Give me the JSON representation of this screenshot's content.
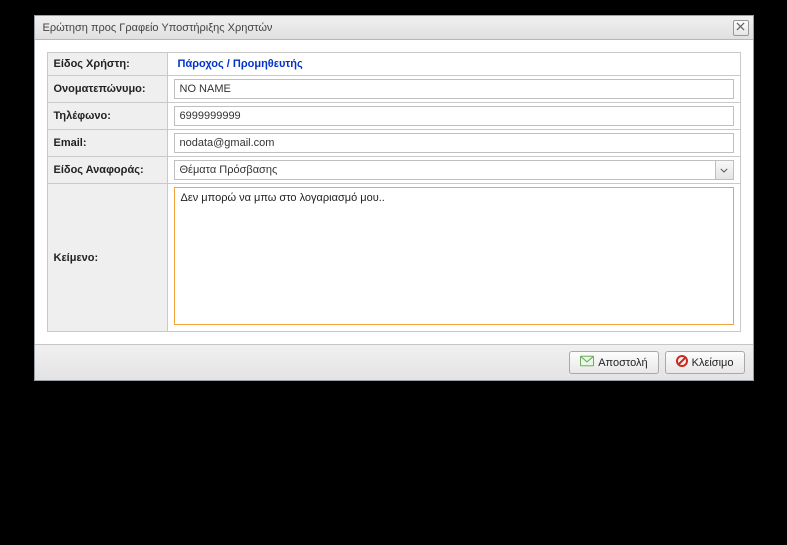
{
  "window": {
    "title": "Ερώτηση προς Γραφείο Υποστήριξης Χρηστών"
  },
  "labels": {
    "userType": "Είδος Χρήστη:",
    "fullName": "Ονοματεπώνυμο:",
    "phone": "Τηλέφωνο:",
    "email": "Email:",
    "reportType": "Είδος Αναφοράς:",
    "message": "Κείμενο:"
  },
  "values": {
    "userType": "Πάροχος / Προμηθευτής",
    "fullName": "NO NAME",
    "phone": "6999999999",
    "email": "nodata@gmail.com",
    "reportType": "Θέματα Πρόσβασης",
    "message": "Δεν μπορώ να μπω στο λογαριασμό μου.."
  },
  "buttons": {
    "submit": "Αποστολή",
    "close": "Κλείσιμο"
  }
}
